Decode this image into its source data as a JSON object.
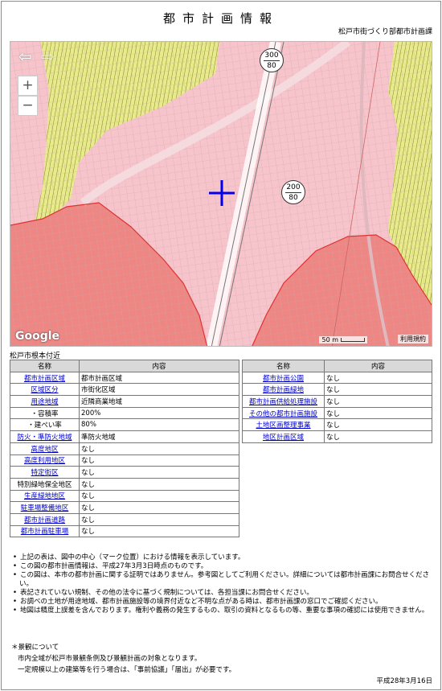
{
  "page": {
    "title": "都市計画情報",
    "department": "松戸市街づくり部都市計画課",
    "location_caption": "松戸市根本付近",
    "date": "平成28年3月16日"
  },
  "map": {
    "nav_back": "⇦",
    "nav_forward": "⇨",
    "zoom_in": "+",
    "zoom_out": "−",
    "logo": "Google",
    "scale_label": "50 m",
    "terms_label": "利用規約",
    "road_label_1_top": "300",
    "road_label_1_bottom": "80",
    "road_label_2_top": "200",
    "road_label_2_bottom": "80",
    "marker_icon": "crosshair-marker",
    "colors": {
      "commercial": "#f7c4cc",
      "neighborhood_commercial": "#ee8684",
      "residential": "#e8ea8c",
      "marker": "#0000ee"
    }
  },
  "table": {
    "header_name": "名称",
    "header_content": "内容",
    "left_rows": [
      {
        "name": "都市計画区域",
        "link": true,
        "value": "都市計画区域"
      },
      {
        "name": "区域区分",
        "link": true,
        "value": "市街化区域"
      },
      {
        "name": "用途地域",
        "link": true,
        "value": "近隣商業地域"
      },
      {
        "name": "・容積率",
        "link": false,
        "value": "200%"
      },
      {
        "name": "・建ぺい率",
        "link": false,
        "value": "80%"
      },
      {
        "name": "防火・準防火地域",
        "link": true,
        "value": "準防火地域"
      },
      {
        "name": "高度地区",
        "link": true,
        "value": "なし"
      },
      {
        "name": "高度利用地区",
        "link": true,
        "value": "なし"
      },
      {
        "name": "特定街区",
        "link": true,
        "value": "なし"
      },
      {
        "name": "特別緑地保全地区",
        "link": false,
        "value": "なし"
      },
      {
        "name": "生産緑地地区",
        "link": true,
        "value": "なし"
      },
      {
        "name": "駐車場整備地区",
        "link": true,
        "value": "なし"
      },
      {
        "name": "都市計画道路",
        "link": true,
        "value": "なし"
      },
      {
        "name": "都市計画駐車場",
        "link": true,
        "value": "なし"
      }
    ],
    "right_rows": [
      {
        "name": "都市計画公園",
        "link": true,
        "value": "なし"
      },
      {
        "name": "都市計画緑地",
        "link": true,
        "value": "なし"
      },
      {
        "name": "都市計画供給処理施設",
        "link": true,
        "value": "なし"
      },
      {
        "name": "その他の都市計画施設",
        "link": true,
        "value": "なし"
      },
      {
        "name": "土地区画整理事業",
        "link": true,
        "value": "なし"
      },
      {
        "name": "地区計画区域",
        "link": true,
        "value": "なし"
      }
    ]
  },
  "notes": [
    "上記の表は、図中の中心（マーク位置）における情報を表示しています。",
    "この図の都市計画情報は、平成27年3月3日時点のものです。",
    "この図は、本市の都市計画に関する証明ではありません。参考図としてご利用ください。詳細については都市計画課にお問合せください。",
    "表記されていない規制、その他の法令に基づく規制については、各担当課にお問合せください。",
    "お調べの土地が用途地域、都市計画施設等の境界付近など不明な点がある時は、都市計画課の窓口でご確認ください。",
    "地図は精度上誤差を含んでおります。権利や義務の発生するもの、取引の資料となるもの等、重要な事項の確認には使用できません。"
  ],
  "landscape": {
    "heading": "＊景観について",
    "line1": "市内全域が松戸市景観条例及び景観計画の対象となります。",
    "line2": "一定規模以上の建築等を行う場合は、「事前協議」「届出」が必要です。"
  }
}
